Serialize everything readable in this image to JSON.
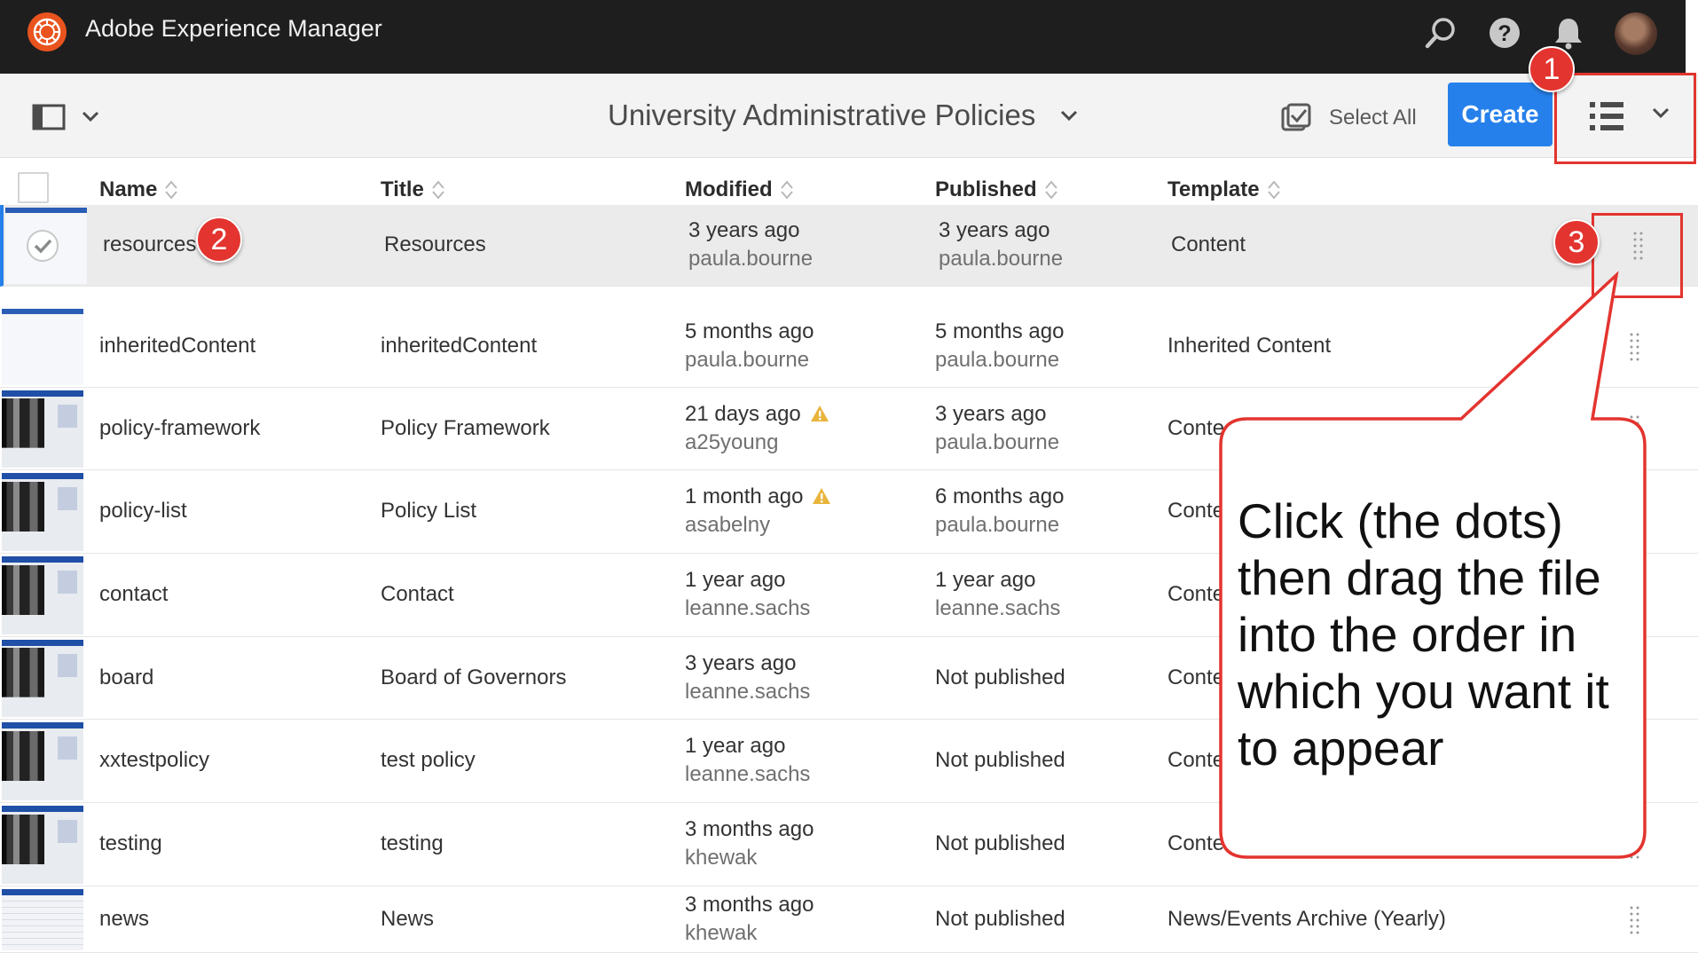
{
  "shell": {
    "app_title": "Adobe Experience Manager",
    "icons": [
      "adobe-logo-icon",
      "search-icon",
      "help-icon",
      "notification-bell-icon",
      "user-avatar"
    ]
  },
  "actionbar": {
    "folder_title": "University Administrative Policies",
    "select_all_label": "Select All",
    "create_label": "Create"
  },
  "table": {
    "columns": [
      "Name",
      "Title",
      "Modified",
      "Published",
      "Template"
    ],
    "rows": [
      {
        "name": "resources",
        "title": "Resources",
        "modified": "3 years ago",
        "modified_by": "paula.bourne",
        "published": "3 years ago",
        "published_by": "paula.bourne",
        "template": "Content",
        "selected": true,
        "warning": false
      },
      {
        "name": "inheritedContent",
        "title": "inheritedContent",
        "modified": "5 months ago",
        "modified_by": "paula.bourne",
        "published": "5 months ago",
        "published_by": "paula.bourne",
        "template": "Inherited Content",
        "selected": false,
        "warning": false
      },
      {
        "name": "policy-framework",
        "title": "Policy Framework",
        "modified": "21 days ago",
        "modified_by": "a25young",
        "published": "3 years ago",
        "published_by": "paula.bourne",
        "template": "Conte",
        "selected": false,
        "warning": true
      },
      {
        "name": "policy-list",
        "title": "Policy List",
        "modified": "1 month ago",
        "modified_by": "asabelny",
        "published": "6 months ago",
        "published_by": "paula.bourne",
        "template": "Conte",
        "selected": false,
        "warning": true
      },
      {
        "name": "contact",
        "title": "Contact",
        "modified": "1 year ago",
        "modified_by": "leanne.sachs",
        "published": "1 year ago",
        "published_by": "leanne.sachs",
        "template": "Conte",
        "selected": false,
        "warning": false
      },
      {
        "name": "board",
        "title": "Board of Governors",
        "modified": "3 years ago",
        "modified_by": "leanne.sachs",
        "published": "Not published",
        "published_by": "",
        "template": "Conte",
        "selected": false,
        "warning": false
      },
      {
        "name": "xxtestpolicy",
        "title": "test policy",
        "modified": "1 year ago",
        "modified_by": "leanne.sachs",
        "published": "Not published",
        "published_by": "",
        "template": "Conte",
        "selected": false,
        "warning": false
      },
      {
        "name": "testing",
        "title": "testing",
        "modified": "3 months ago",
        "modified_by": "khewak",
        "published": "Not published",
        "published_by": "",
        "template": "Conte",
        "selected": false,
        "warning": false
      },
      {
        "name": "news",
        "title": "News",
        "modified": "3 months ago",
        "modified_by": "khewak",
        "published": "Not published",
        "published_by": "",
        "template": "News/Events Archive (Yearly)",
        "selected": false,
        "warning": false
      }
    ]
  },
  "annotations": {
    "markers": [
      "1",
      "2",
      "3"
    ],
    "callout": "Click (the dots) then drag the file into the order in which you want it to appear",
    "color": "#e3342f"
  }
}
